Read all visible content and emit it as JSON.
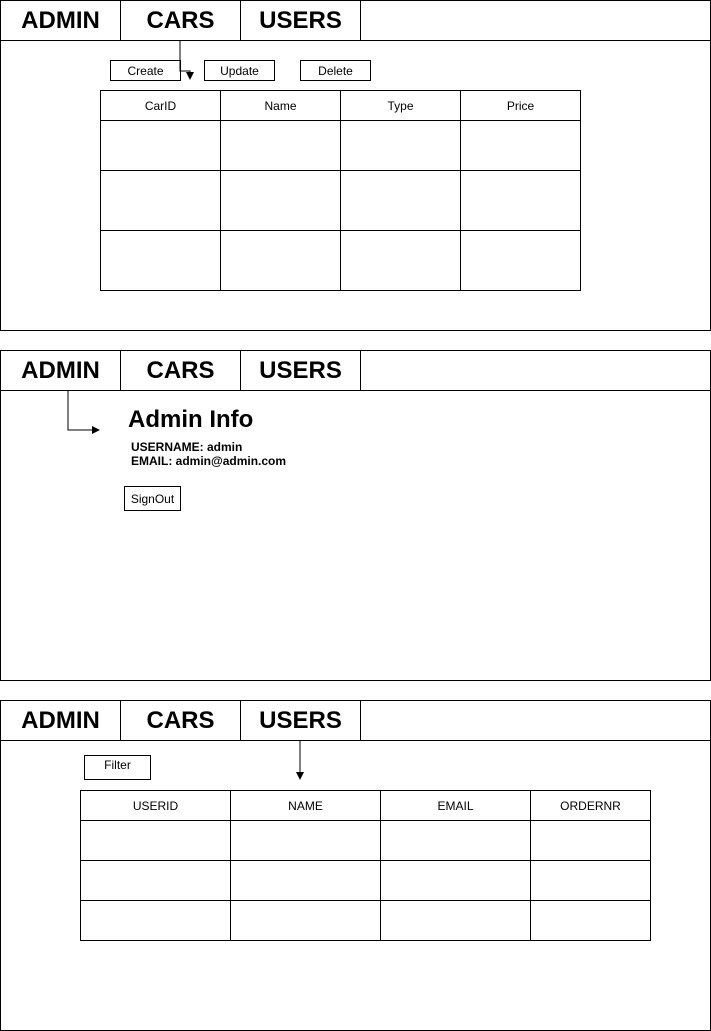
{
  "nav": {
    "admin_label": "ADMIN",
    "cars_label": "CARS",
    "users_label": "USERS"
  },
  "cars_screen": {
    "buttons": {
      "create": "Create",
      "update": "Update",
      "delete": "Delete"
    },
    "table": {
      "headers": [
        "CarID",
        "Name",
        "Type",
        "Price"
      ],
      "rows": [
        [
          "",
          "",
          "",
          ""
        ],
        [
          "",
          "",
          "",
          ""
        ],
        [
          "",
          "",
          "",
          ""
        ]
      ]
    }
  },
  "admin_screen": {
    "title": "Admin Info",
    "username_line": "USERNAME: admin",
    "email_line": "EMAIL: admin@admin.com",
    "signout_label": "SignOut"
  },
  "users_screen": {
    "filter_label": "Filter",
    "table": {
      "headers": [
        "USERID",
        "NAME",
        "EMAIL",
        "ORDERNR"
      ],
      "rows": [
        [
          "",
          "",
          "",
          ""
        ],
        [
          "",
          "",
          "",
          ""
        ],
        [
          "",
          "",
          "",
          ""
        ]
      ]
    }
  }
}
